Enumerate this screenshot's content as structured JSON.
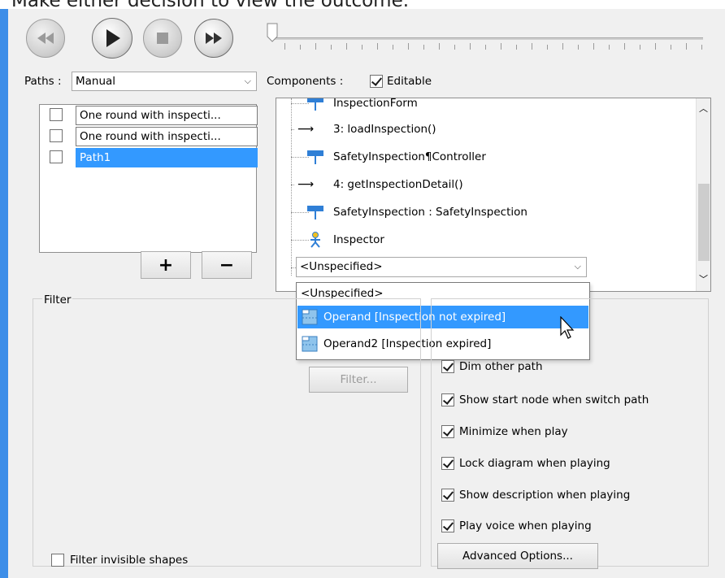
{
  "caption": "Make either decision to view the outcome.",
  "playback": {
    "rewind_icon": "rewind-icon",
    "play_icon": "play-icon",
    "stop_icon": "stop-icon",
    "fastforward_icon": "fast-forward-icon"
  },
  "paths": {
    "label": "Paths :",
    "mode": "Manual",
    "items": [
      {
        "label": "One round with inspecti...",
        "checked": false,
        "selected": false
      },
      {
        "label": "One round with inspecti...",
        "checked": false,
        "selected": false
      },
      {
        "label": "Path1",
        "checked": false,
        "selected": true
      }
    ],
    "add_label": "+",
    "remove_label": "−"
  },
  "components": {
    "label": "Components :",
    "editable_label": "Editable",
    "editable_checked": true,
    "tree": [
      {
        "text": "InspectionForm",
        "icon": "lifeline-icon"
      },
      {
        "text": "3: loadInspection()",
        "icon": "message-arrow-icon"
      },
      {
        "text": "SafetyInspection¶Controller",
        "icon": "lifeline-icon"
      },
      {
        "text": "4: getInspectionDetail()",
        "icon": "message-arrow-icon"
      },
      {
        "text": "SafetyInspection : SafetyInspection",
        "icon": "lifeline-icon"
      },
      {
        "text": "Inspector",
        "icon": "actor-icon"
      }
    ],
    "combo_value": "<Unspecified>",
    "dropdown": [
      {
        "text": "<Unspecified>",
        "icon": "",
        "highlighted": false
      },
      {
        "text": "Operand [Inspection not expired]",
        "icon": "combined-fragment-icon",
        "highlighted": true
      },
      {
        "text": "Operand2 [Inspection expired]",
        "icon": "combined-fragment-icon",
        "highlighted": false
      }
    ]
  },
  "filter": {
    "label": "Filter",
    "button": "Filter...",
    "invisible_label": "Filter invisible shapes"
  },
  "options": {
    "items": [
      {
        "label": "Dim other path",
        "checked": true
      },
      {
        "label": "Show start node when switch path",
        "checked": true
      },
      {
        "label": "Minimize when play",
        "checked": true
      },
      {
        "label": "Lock diagram when playing",
        "checked": true
      },
      {
        "label": "Show description when playing",
        "checked": true
      },
      {
        "label": "Play voice when playing",
        "checked": true
      }
    ],
    "advanced_button": "Advanced Options..."
  },
  "colors": {
    "selection": "#3399ff",
    "accent_bar": "#3d8ee8",
    "panel_bg": "#f0f0f0"
  }
}
